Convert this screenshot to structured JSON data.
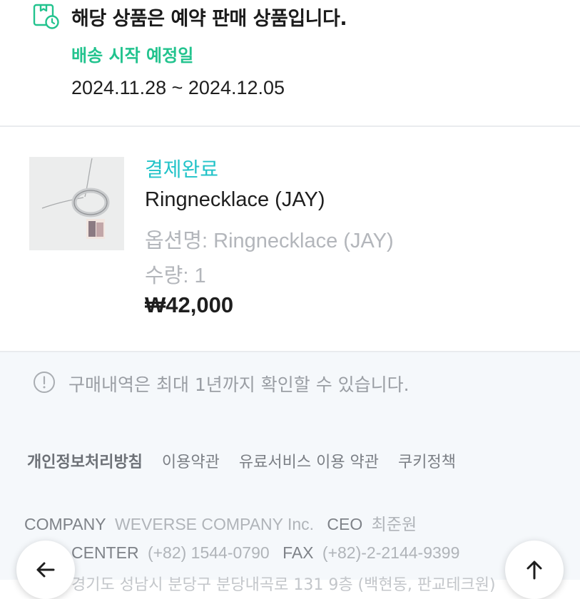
{
  "notice": {
    "title": "해당 상품은 예약 판매 상품입니다.",
    "ship_label": "배송 시작 예정일",
    "ship_dates": "2024.11.28 ~ 2024.12.05",
    "icon": "box-clock-icon"
  },
  "order": {
    "status": "결제완료",
    "product_name": "Ringnecklace (JAY)",
    "option_text": "옵션명: Ringnecklace (JAY)",
    "quantity_text": "수량: 1",
    "price": "₩42,000",
    "thumbnail_icon": "ring-necklace-photo"
  },
  "history_notice": {
    "text": "구매내역은 최대 1년까지 확인할 수 있습니다.",
    "icon": "info-circle-icon"
  },
  "footer": {
    "links": [
      "개인정보처리방침",
      "이용약관",
      "유료서비스 이용 약관",
      "쿠키정책"
    ],
    "company_label": "COMPANY",
    "company_value": "WEVERSE COMPANY Inc.",
    "ceo_label": "CEO",
    "ceo_value": "최준원",
    "cs_label": "CENTER",
    "cs_value": "(+82) 1544-0790",
    "fax_label": "FAX",
    "fax_value": "(+82)-2-2144-9399",
    "address": "경기도 성남시 분당구 분당내곡로 131 9층 (백현동, 판교테크원)"
  },
  "buttons": {
    "back_icon": "arrow-left-icon",
    "top_icon": "arrow-up-icon"
  },
  "colors": {
    "accent_green": "#22c38e",
    "accent_teal": "#22c3c8",
    "muted_text": "#b3b6bb",
    "footer_bg": "#f5f8fb"
  }
}
